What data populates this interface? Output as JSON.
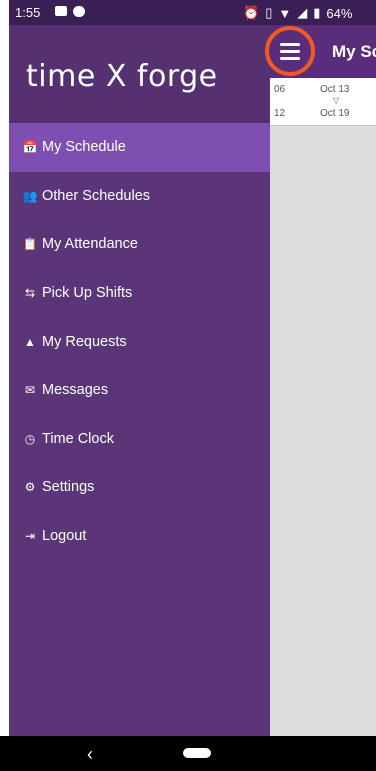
{
  "status": {
    "time": "1:55",
    "battery": "64%"
  },
  "drawer": {
    "logo": "time X forge",
    "items": [
      {
        "icon": "📅",
        "label": "My Schedule",
        "active": true
      },
      {
        "icon": "👥",
        "label": "Other Schedules"
      },
      {
        "icon": "📋",
        "label": "My Attendance"
      },
      {
        "icon": "⇆",
        "label": "Pick Up Shifts"
      },
      {
        "icon": "▲",
        "label": "My Requests"
      },
      {
        "icon": "✉",
        "label": "Messages"
      },
      {
        "icon": "◷",
        "label": "Time Clock"
      },
      {
        "icon": "⚙",
        "label": "Settings"
      },
      {
        "icon": "⇥",
        "label": "Logout"
      }
    ]
  },
  "appbar": {
    "title": "My Sc"
  },
  "dates": {
    "a": "06",
    "b": "12",
    "c": "Oct 13",
    "d": "Oct 19"
  },
  "navbar": {
    "back": "‹"
  }
}
